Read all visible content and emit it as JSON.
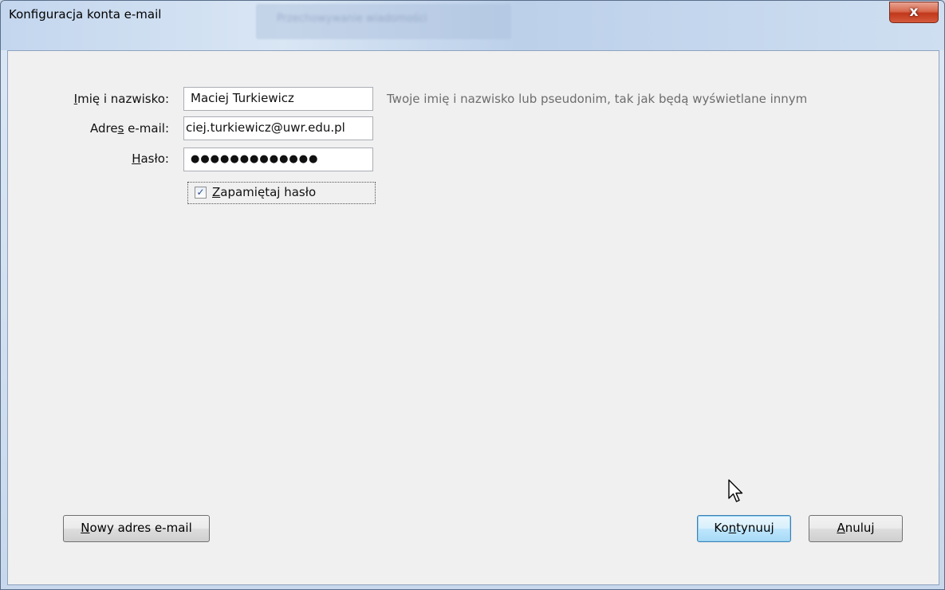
{
  "window": {
    "title": "Konfiguracja konta e-mail",
    "background_title": "Przechowywanie wiadomości",
    "close_glyph": "x"
  },
  "form": {
    "name_label_prefix": "",
    "name_label_u": "I",
    "name_label_rest": "mię i nazwisko:",
    "name_value": "Maciej Turkiewicz",
    "name_hint": "Twoje imię i nazwisko lub pseudonim, tak jak będą wyświetlane innym",
    "email_label_prefix": "Adre",
    "email_label_u": "s",
    "email_label_rest": " e-mail:",
    "email_value": "ciej.turkiewicz@uwr.edu.pl",
    "password_label_prefix": "",
    "password_label_u": "H",
    "password_label_rest": "asło:",
    "password_value": "●●●●●●●●●●●●●",
    "remember_checked_glyph": "✓",
    "remember_label_u": "Z",
    "remember_label_rest": "apamiętaj hasło"
  },
  "buttons": {
    "new_address_u": "N",
    "new_address_rest": "owy adres e-mail",
    "continue_prefix": "Ko",
    "continue_u": "n",
    "continue_rest": "tynuuj",
    "cancel_u": "A",
    "cancel_rest": "nuluj"
  },
  "colors": {
    "close_button": "#c1381c",
    "default_button_border": "#3c7fb1",
    "hint_text": "#6d6d6d"
  },
  "icons": {
    "cursor": "arrow-cursor-icon",
    "close": "close-icon",
    "checkbox": "checkmark-icon"
  }
}
